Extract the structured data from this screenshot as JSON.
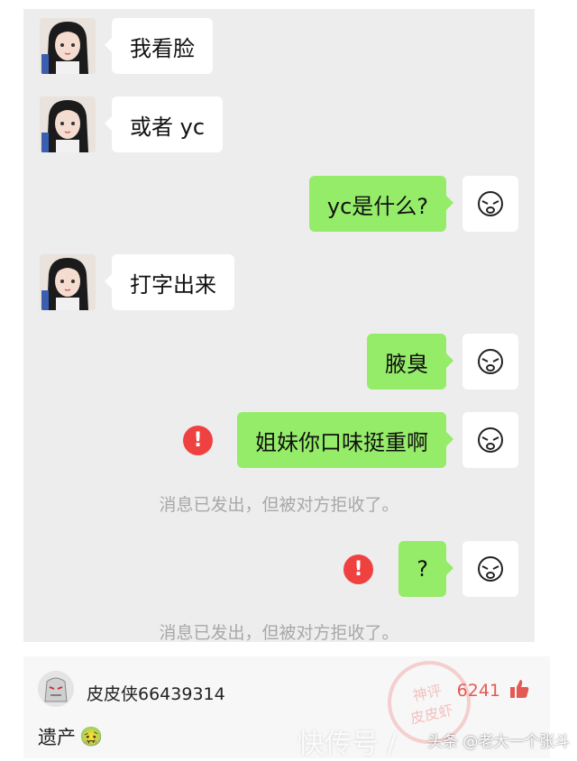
{
  "messages": [
    {
      "text": "我看脸"
    },
    {
      "text": "或者 yc"
    },
    {
      "text": "yc是什么?"
    },
    {
      "text": "打字出来"
    },
    {
      "text": "腋臭"
    },
    {
      "text": "姐妹你口味挺重啊"
    },
    {
      "text": "?"
    }
  ],
  "system_notice": "消息已发出，但被对方拒收了。",
  "error_glyph": "!",
  "comment": {
    "user": "皮皮侠66439314",
    "likes": "6241",
    "text": "遗产",
    "emoji": "🤢"
  },
  "stamp": {
    "line1": "神评",
    "line2": "皮皮虾"
  },
  "watermark": {
    "main": "快传号 /",
    "sub": "头条 @老大一个张斗"
  },
  "colors": {
    "bubble_green": "#95ec69",
    "error_red": "#f04141",
    "like_red": "#e35a55"
  }
}
